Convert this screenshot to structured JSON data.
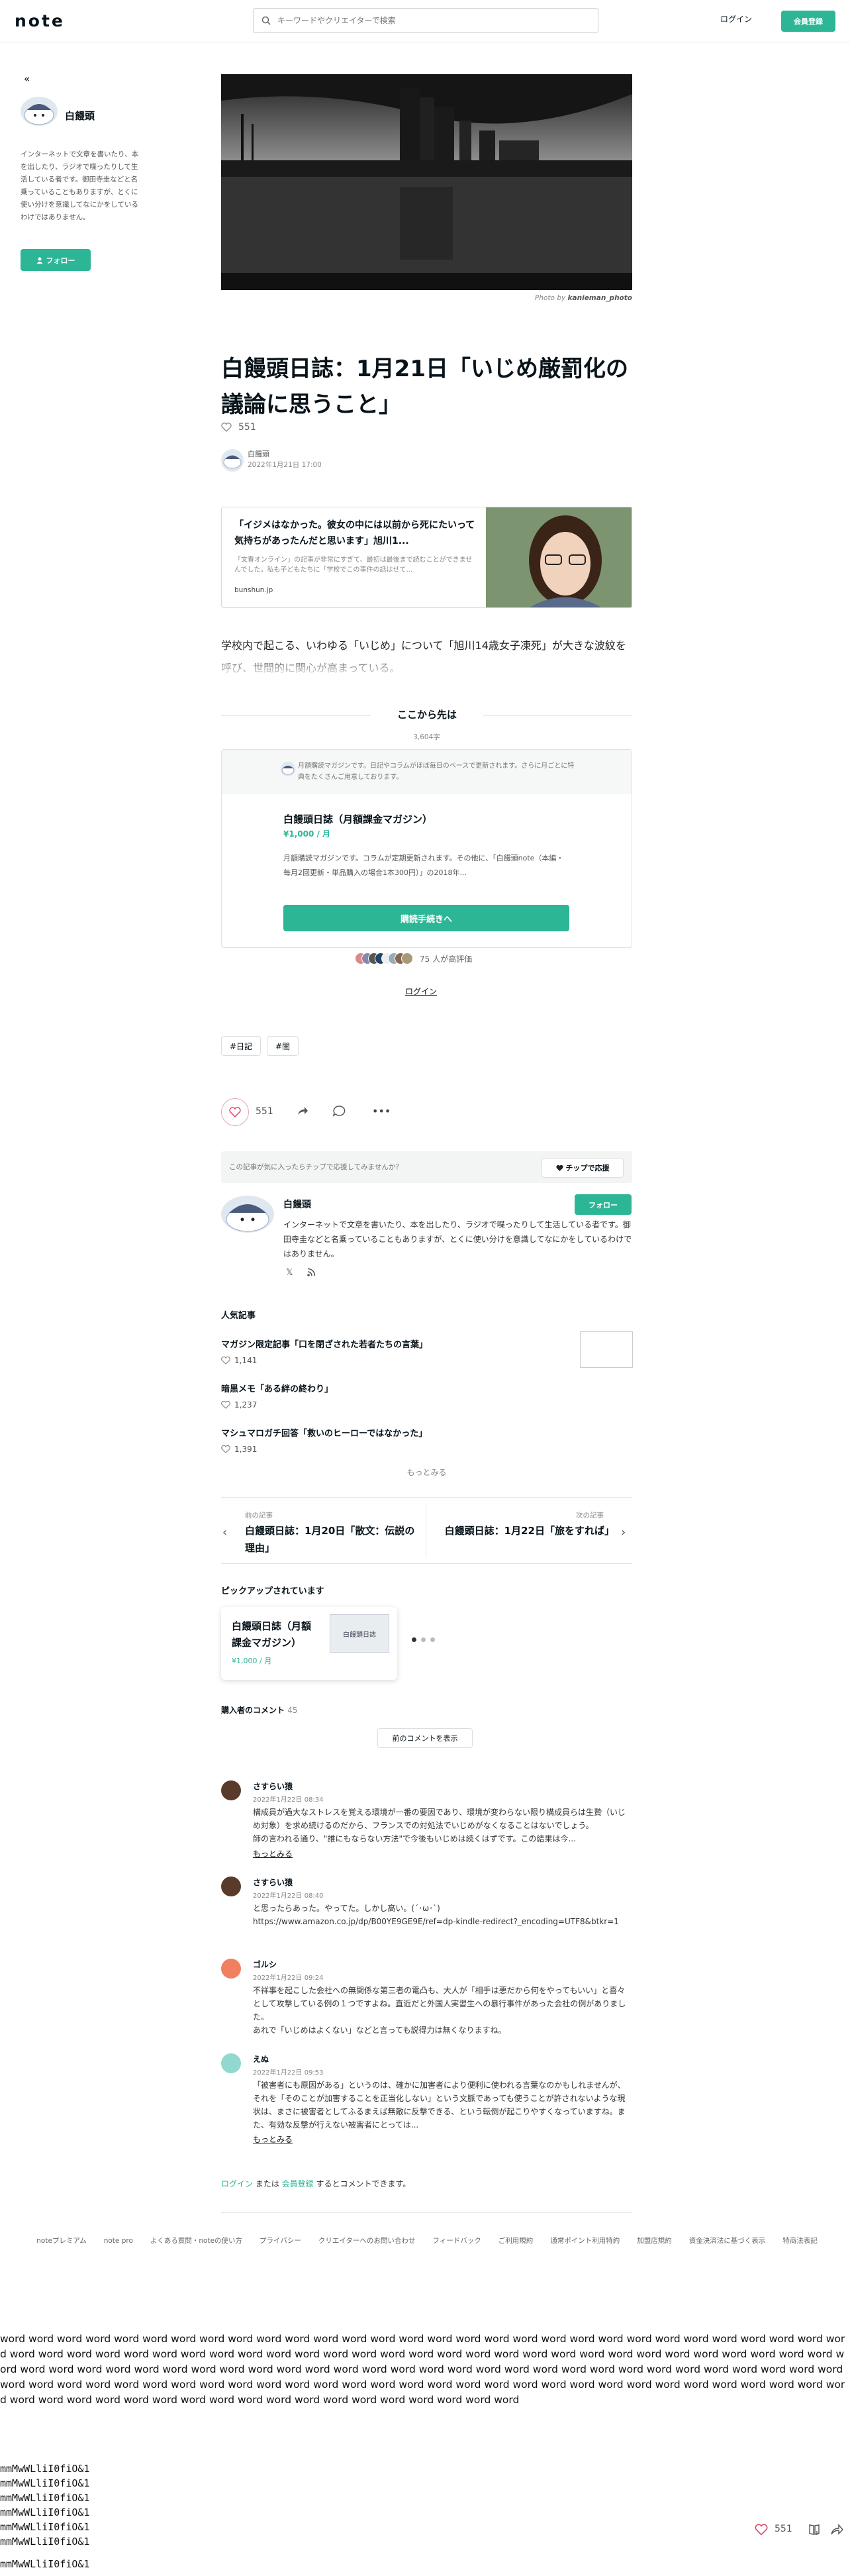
{
  "header": {
    "logo": "note",
    "search_placeholder": "キーワードやクリエイターで検索",
    "login": "ログイン",
    "signup": "会員登録"
  },
  "sidebar": {
    "author": "白饅頭",
    "bio": "インターネットで文章を書いたり、本を出したり、ラジオで喋ったりして生活している者です。御田寺圭などと名乗っていることもありますが、とくに使い分けを意識してなにかをしているわけではありません。",
    "follow": "フォロー"
  },
  "article": {
    "photo_credit_prefix": "Photo by",
    "photo_credit_name": "kanieman_photo",
    "title": "白饅頭日誌：1月21日「いじめ厳罰化の議論に思うこと」",
    "like_count": "551",
    "author": "白饅頭",
    "date": "2022年1月21日 17:00",
    "body_preview": "学校内で起こる、いわゆる「いじめ」について「旭川14歳女子凍死」が大きな波紋を呼び、世間的に関心が高まっている。"
  },
  "embed": {
    "title": "「イジメはなかった。彼女の中には以前から死にたいって気持ちがあったんだと思います」旭川1...",
    "desc": "「文春オンライン」の記事が非常にすぎて、最初は最後まで読むことができませんでした。私も子どもたちに「学校でこの事件の話はせて...",
    "domain": "bunshun.jp"
  },
  "paywall": {
    "label": "ここから先は",
    "char_count": "3,604字"
  },
  "magazine": {
    "head_text": "月額購読マガジンです。日記やコラムがほぼ毎日のペースで更新されます。さらに月ごとに特典をたくさんご用意しております。",
    "title": "白饅頭日誌（月額課金マガジン）",
    "price": "¥1,000 / 月",
    "desc": "月額購読マガジンです。コラムが定期更新されます。その他に、「白饅頭note（本編・毎月2回更新・単品購入の場合1本300円）」の2018年...",
    "button": "購読手続きへ",
    "eval_text": "75 人が高評価",
    "login": "ログイン"
  },
  "tags": [
    "#日記",
    "#闇"
  ],
  "actions": {
    "like_count": "551",
    "more": "•••"
  },
  "tip": {
    "text": "この記事が気に入ったらチップで応援してみませんか？",
    "button": "チップで応援"
  },
  "creator": {
    "name": "白饅頭",
    "follow": "フォロー",
    "bio": "インターネットで文章を書いたり、本を出したり、ラジオで喋ったりして生活している者です。御田寺圭などと名乗っていることもありますが、とくに使い分けを意識してなにかをしているわけではありません。",
    "x_icon": "𝕏"
  },
  "popular": {
    "heading": "人気記事",
    "items": [
      {
        "title": "マガジン限定記事「口を閉ざされた若者たちの言葉」",
        "likes": "1,141"
      },
      {
        "title": "暗黒メモ「ある絆の終わり」",
        "likes": "1,237"
      },
      {
        "title": "マシュマロガチ回答「救いのヒーローではなかった」",
        "likes": "1,391"
      }
    ],
    "more": "もっとみる"
  },
  "prevnext": {
    "prev_label": "前の記事",
    "prev_title": "白饅頭日誌：1月20日「散文：伝説の理由」",
    "next_label": "次の記事",
    "next_title": "白饅頭日誌：1月22日「旅をすれば」"
  },
  "pickup": {
    "heading": "ピックアップされています",
    "title": "白饅頭日誌（月額課金マガジン）",
    "price": "¥1,000 / 月",
    "thumb_text": "白饅頭日誌"
  },
  "comments": {
    "heading": "購入者のコメント",
    "count": "45",
    "show_prev": "前のコメントを表示",
    "items": [
      {
        "name": "さすらい猿",
        "date": "2022年1月22日 08:34",
        "text": "構成員が過大なストレスを覚える環境が一番の要因であり、環境が変わらない限り構成員らは生贄（いじめ対象）を求め続けるのだから、フランスでの対処法でいじめがなくなることはないでしょう。\n師の言われる通り、\"誰にもならない方法\"で今後もいじめは続くはずです。この結果は今...",
        "more": "もっとみる",
        "color": "#5a3a2a"
      },
      {
        "name": "さすらい猿",
        "date": "2022年1月22日 08:40",
        "text": "と思ったらあった。やってた。しかし高い。(´･ω･`)\nhttps://www.amazon.co.jp/dp/B00YE9GE9E/ref=dp-kindle-redirect?_encoding=UTF8&btkr=1",
        "more": "",
        "color": "#5a3a2a"
      },
      {
        "name": "ゴルシ",
        "date": "2022年1月22日 09:24",
        "text": "不祥事を起こした会社への無関係な第三者の電凸も、大人が「相手は悪だから何をやってもいい」と喜々として攻撃している例の１つですよね。直近だと外国人実習生への暴行事件があった会社の例がありました。\nあれで「いじめはよくない」などと言っても説得力は無くなりますね。",
        "more": "",
        "color": "#f08060"
      },
      {
        "name": "えぬ",
        "date": "2022年1月22日 09:53",
        "text": "「被害者にも原因がある」というのは、確かに加害者により便利に使われる言葉なのかもしれませんが、それを「そのことが加害することを正当化しない」という文脈であっても使うことが許されないような現状は、まさに被害者としてふるまえば無敵に反撃できる、という転倒が起こりやすくなっていますね。また、有効な反撃が行えない被害者にとっては...",
        "more": "もっとみる",
        "color": "#90d8d0"
      }
    ],
    "login_prefix": "ログイン",
    "login_or": " または ",
    "login_signup": "会員登録",
    "login_suffix": " するとコメントできます。"
  },
  "footer": {
    "links": [
      "noteプレミアム",
      "note pro",
      "よくある質問・noteの使い方",
      "プライバシー",
      "クリエイターへのお問い合わせ",
      "フィードバック",
      "ご利用規約",
      "通常ポイント利用特約",
      "加盟店規約",
      "資金決済法に基づく表示",
      "特商法表記"
    ]
  },
  "filler": {
    "word": "word",
    "word_count": 137,
    "mono_lines": [
      "mmMwWLliI0fiO&1",
      "mmMwWLliI0fiO&1",
      "mmMwWLliI0fiO&1",
      "mmMwWLliI0fiO&1",
      "mmMwWLliI0fiO&1",
      "mmMwWLliI0fiO&1"
    ],
    "mono_last": "mmMwWLliI0fiO&1"
  },
  "floating": {
    "like_count": "551"
  }
}
